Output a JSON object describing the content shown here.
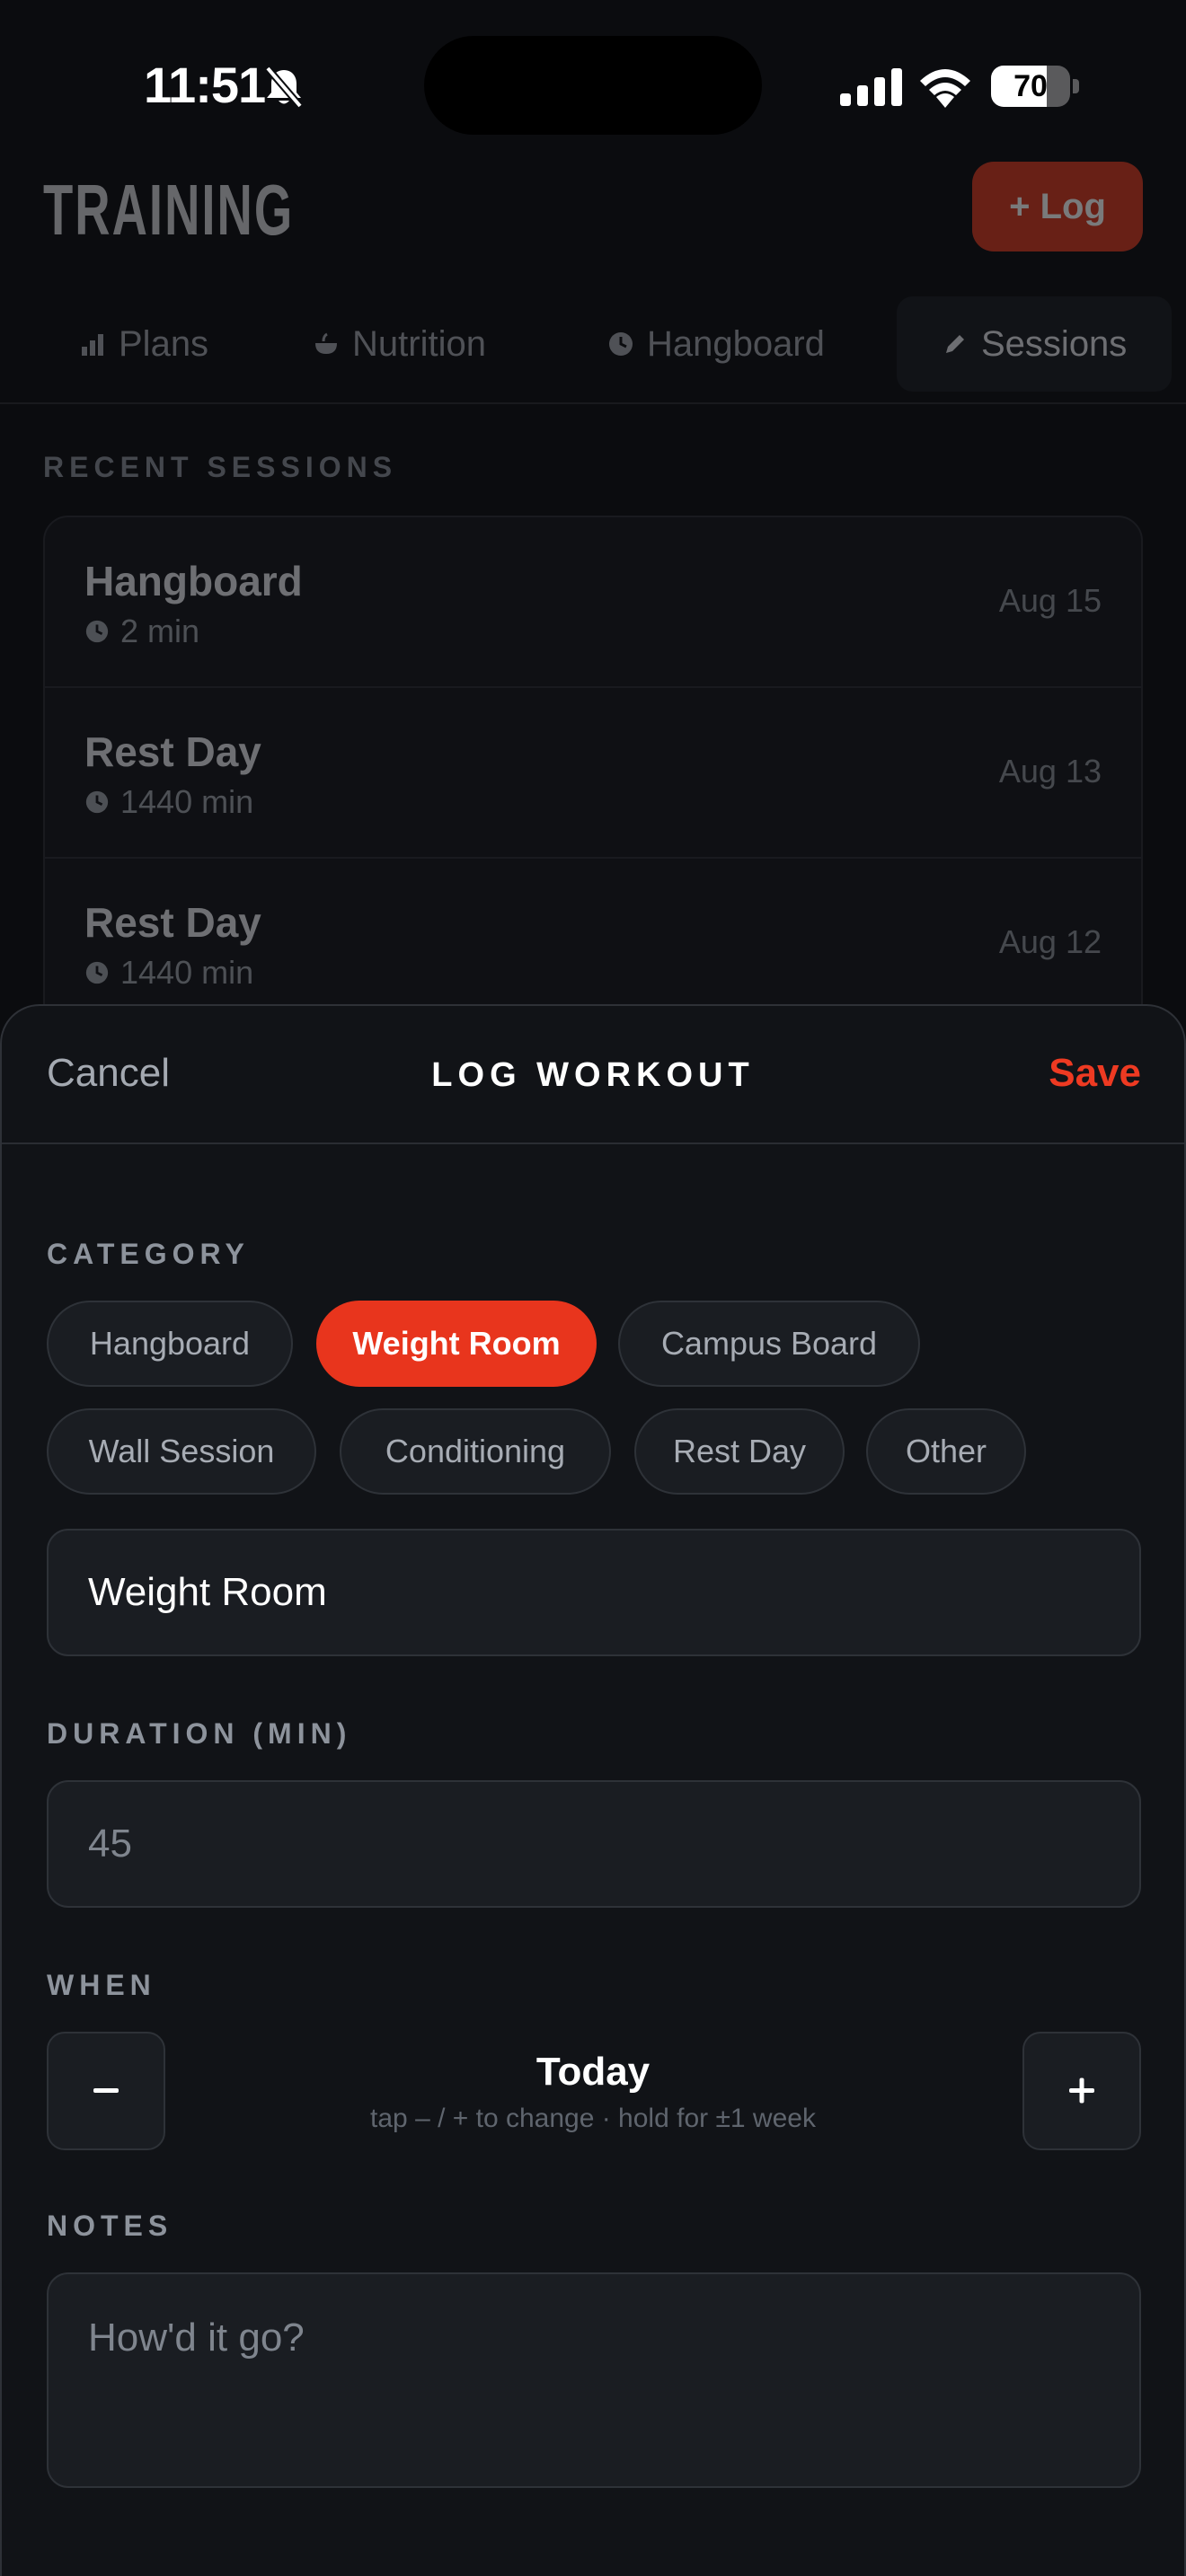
{
  "status_bar": {
    "time": "11:51",
    "battery_percent": "70",
    "battery_level": 0.7,
    "icons": [
      "bell-slash-icon",
      "cellular-signal-icon",
      "wifi-icon",
      "battery-icon"
    ]
  },
  "app": {
    "title": "TRAINING",
    "log_button": "+ Log",
    "tabs": [
      {
        "label": "Plans",
        "icon": "bar-chart-icon"
      },
      {
        "label": "Nutrition",
        "icon": "bowl-icon"
      },
      {
        "label": "Hangboard",
        "icon": "clock-icon"
      },
      {
        "label": "Sessions",
        "icon": "pencil-icon",
        "active": true
      }
    ],
    "recent_sessions_label": "RECENT SESSIONS",
    "sessions": [
      {
        "name": "Hangboard",
        "duration": "2 min",
        "date": "Aug 15"
      },
      {
        "name": "Rest Day",
        "duration": "1440 min",
        "date": "Aug 13"
      },
      {
        "name": "Rest Day",
        "duration": "1440 min",
        "date": "Aug 12"
      }
    ]
  },
  "sheet": {
    "cancel": "Cancel",
    "title": "LOG WORKOUT",
    "save": "Save",
    "category_label": "CATEGORY",
    "categories": [
      {
        "label": "Hangboard",
        "selected": false
      },
      {
        "label": "Weight Room",
        "selected": true
      },
      {
        "label": "Campus Board",
        "selected": false
      },
      {
        "label": "Wall Session",
        "selected": false
      },
      {
        "label": "Conditioning",
        "selected": false
      },
      {
        "label": "Rest Day",
        "selected": false
      },
      {
        "label": "Other",
        "selected": false
      }
    ],
    "name_value": "Weight Room",
    "duration_label": "DURATION (MIN)",
    "duration_placeholder": "45",
    "when_label": "WHEN",
    "when_value": "Today",
    "when_hint": "tap – / + to change · hold for ±1 week",
    "notes_label": "NOTES",
    "notes_placeholder": "How'd it go?"
  },
  "colors": {
    "accent": "#e8351d",
    "background": "#0b0c0f",
    "sheet": "#111317",
    "field": "#1a1d22"
  }
}
